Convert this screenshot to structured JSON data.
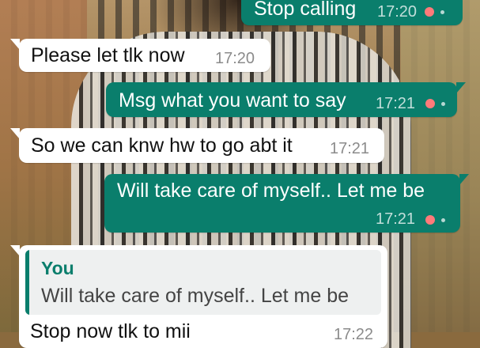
{
  "chat": {
    "messages": [
      {
        "direction": "out",
        "text": "Stop calling",
        "time": "17:20",
        "status": "pending"
      },
      {
        "direction": "in",
        "text": "Please let tlk now",
        "time": "17:20"
      },
      {
        "direction": "out",
        "text": "Msg what you want to say",
        "time": "17:21",
        "status": "pending"
      },
      {
        "direction": "in",
        "text": "So we can knw hw to go abt it",
        "time": "17:21"
      },
      {
        "direction": "out",
        "text": "Will take care of myself.. Let me be",
        "time": "17:21",
        "status": "pending"
      },
      {
        "direction": "in",
        "quote": {
          "author": "You",
          "text": "Will take care of myself.. Let me be"
        },
        "text": "Stop now tlk to mii",
        "time": "17:22"
      }
    ]
  },
  "colors": {
    "outgoing_bubble": "#0a7e6c",
    "incoming_bubble": "#ffffff",
    "pending_dot": "#ff7a7a",
    "quote_accent": "#0a7e6c"
  },
  "icons": {
    "status": "pending-clock-icon"
  }
}
